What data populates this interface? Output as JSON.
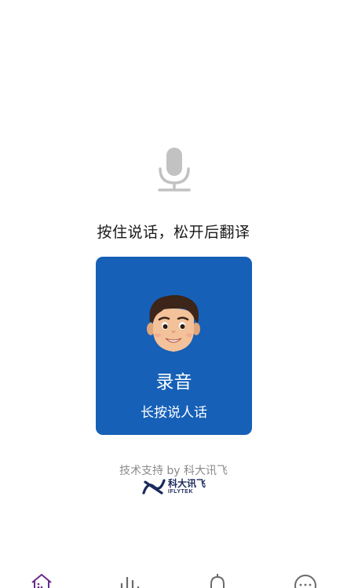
{
  "main": {
    "instruction": "按住说话，松开后翻译",
    "record_title": "录音",
    "record_subtitle": "长按说人话"
  },
  "footer": {
    "powered_by": "技术支持 by 科大讯飞",
    "brand_cn": "科大讯飞",
    "brand_en": "IFLYTEK"
  },
  "tabbar": {
    "tabs": [
      {
        "icon": "home-icon",
        "active": true
      },
      {
        "icon": "stats-icon",
        "active": false
      },
      {
        "icon": "bell-icon",
        "active": false
      },
      {
        "icon": "chat-icon",
        "active": false
      }
    ]
  },
  "colors": {
    "accent": "#1660b7",
    "active_tab": "#6a2a8a",
    "icon_gray": "#c2c2c2",
    "brand_navy": "#1b2a5a"
  }
}
